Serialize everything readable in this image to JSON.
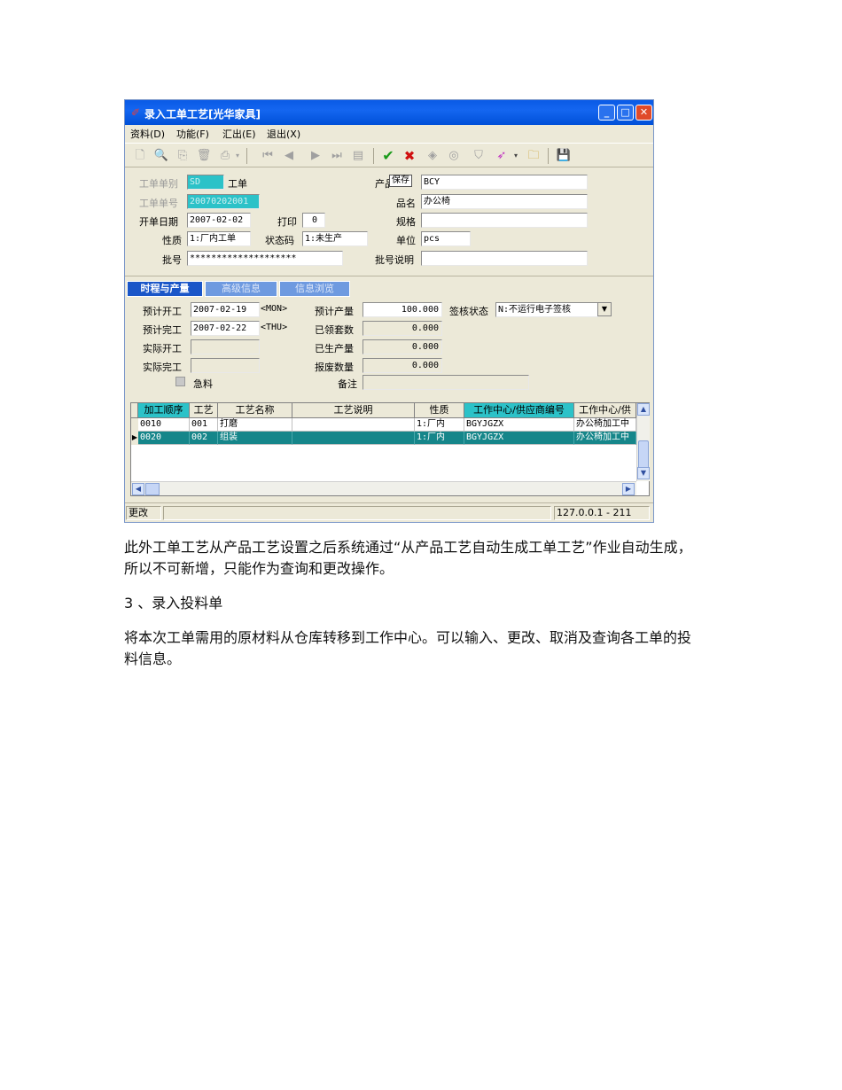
{
  "window": {
    "title": "录入工单工艺[光华家具]",
    "menu": [
      "资料(D)",
      "功能(F)",
      "汇出(E)",
      "退出(X)"
    ]
  },
  "header": {
    "order_type_label": "工单单别",
    "order_type_value": "SD",
    "order_type_name": "工单",
    "order_no_label": "工单单号",
    "order_no_value": "20070202001",
    "open_date_label": "开单日期",
    "open_date_value": "2007-02-02",
    "print_label": "打印",
    "print_value": "0",
    "nature_label": "性质",
    "nature_value": "1:厂内工单",
    "status_label": "状态码",
    "status_value": "1:未生产",
    "batch_label": "批号",
    "batch_value": "********************",
    "product_label": "产品",
    "product_tooltip": "保存",
    "product_value": "BCY",
    "name_label": "品名",
    "name_value": "办公椅",
    "spec_label": "规格",
    "spec_value": "",
    "unit_label": "单位",
    "unit_value": "pcs",
    "batch_note_label": "批号说明",
    "batch_note_value": ""
  },
  "tabs": [
    "时程与产量",
    "高级信息",
    "信息浏览"
  ],
  "schedule": {
    "plan_start_label": "预计开工",
    "plan_start_value": "2007-02-19",
    "plan_start_day": "<MON>",
    "plan_end_label": "预计完工",
    "plan_end_value": "2007-02-22",
    "plan_end_day": "<THU>",
    "actual_start_label": "实际开工",
    "actual_end_label": "实际完工",
    "urgent_label": "急料",
    "plan_qty_label": "预计产量",
    "plan_qty_value": "100.000",
    "received_sets_label": "已领套数",
    "received_sets_value": "0.000",
    "produced_label": "已生产量",
    "produced_value": "0.000",
    "scrap_label": "报废数量",
    "scrap_value": "0.000",
    "remark_label": "备注",
    "sign_status_label": "签核状态",
    "sign_status_value": "N:不运行电子签核"
  },
  "grid": {
    "columns": [
      "加工顺序",
      "工艺",
      "工艺名称",
      "工艺说明",
      "性质",
      "工作中心/供应商编号",
      "工作中心/供"
    ],
    "rows": [
      [
        "0010",
        "001",
        "打磨",
        "",
        "1:厂内",
        "BGYJGZX",
        "办公椅加工中"
      ],
      [
        "0020",
        "002",
        "组装",
        "",
        "1:厂内",
        "BGYJGZX",
        "办公椅加工中"
      ]
    ]
  },
  "statusbar": {
    "mode": "更改",
    "server": "127.0.0.1 - 211"
  },
  "text": {
    "p1": "此外工单工艺从产品工艺设置之后系统通过“从产品工艺自动生成工单工艺”作业自动生成，所以不可新增，只能作为查询和更改操作。",
    "p2": "3 、录入投料单",
    "p3": "将本次工单需用的原材料从仓库转移到工作中心。可以输入、更改、取消及查询各工单的投料信息。"
  }
}
